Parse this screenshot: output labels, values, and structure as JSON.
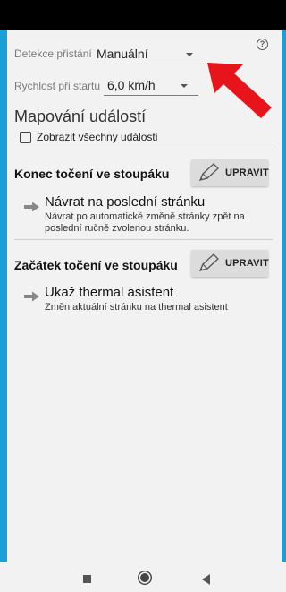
{
  "settings": {
    "detection_label": "Detekce přistání",
    "detection_value": "Manuální",
    "speed_label": "Rychlost při startu",
    "speed_value": "6,0 km/h"
  },
  "mapping": {
    "title": "Mapování událostí",
    "show_all_label": "Zobrazit všechny události"
  },
  "events": [
    {
      "title": "Konec točení ve stoupáku",
      "edit_label": "UPRAVIT",
      "action_title": "Návrat na poslední stránku",
      "action_desc": "Návrat po automatické změně stránky zpět na poslední ručně zvolenou stránku."
    },
    {
      "title": "Začátek točení ve stoupáku",
      "edit_label": "UPRAVIT",
      "action_title": "Ukaž thermal asistent",
      "action_desc": "Změn aktuální stránku na thermal asistent"
    }
  ],
  "help_icon": "?",
  "colors": {
    "frame": "#1aa0d8",
    "annotation_arrow": "#e8141c"
  }
}
